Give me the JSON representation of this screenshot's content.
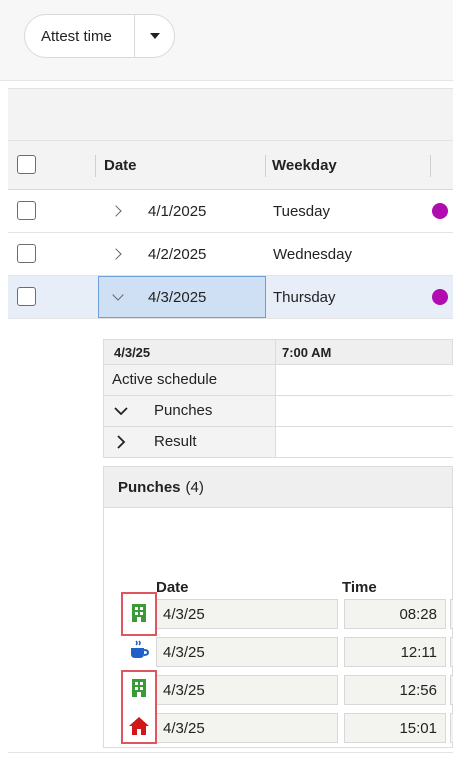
{
  "toolbar": {
    "attest_button_label": "Attest time"
  },
  "grid": {
    "columns": {
      "date": "Date",
      "weekday": "Weekday"
    },
    "rows": [
      {
        "date": "4/1/2025",
        "weekday": "Tuesday",
        "has_dot": true,
        "expanded": false,
        "selected": false
      },
      {
        "date": "4/2/2025",
        "weekday": "Wednesday",
        "has_dot": false,
        "expanded": false,
        "selected": false
      },
      {
        "date": "4/3/2025",
        "weekday": "Thursday",
        "has_dot": true,
        "expanded": true,
        "selected": true
      }
    ],
    "status_dot_color": "#b00cb0"
  },
  "details": {
    "header_date": "4/3/25",
    "header_time": "7:00 AM",
    "rows": [
      {
        "label": "Active schedule"
      },
      {
        "label": "Punches",
        "chevron": "down"
      },
      {
        "label": "Result",
        "chevron": "right"
      }
    ]
  },
  "punches": {
    "title": "Punches",
    "count": "(4)",
    "columns": {
      "date": "Date",
      "time": "Time"
    },
    "items": [
      {
        "icon": "building-icon",
        "date": "4/3/25",
        "time": "08:28"
      },
      {
        "icon": "coffee-icon",
        "date": "4/3/25",
        "time": "12:11"
      },
      {
        "icon": "building-icon",
        "date": "4/3/25",
        "time": "12:56"
      },
      {
        "icon": "home-icon",
        "date": "4/3/25",
        "time": "15:01"
      }
    ]
  },
  "colors": {
    "building": "#3a9a35",
    "coffee": "#1f5fc7",
    "home": "#d11818",
    "highlight": "#e0565e"
  }
}
